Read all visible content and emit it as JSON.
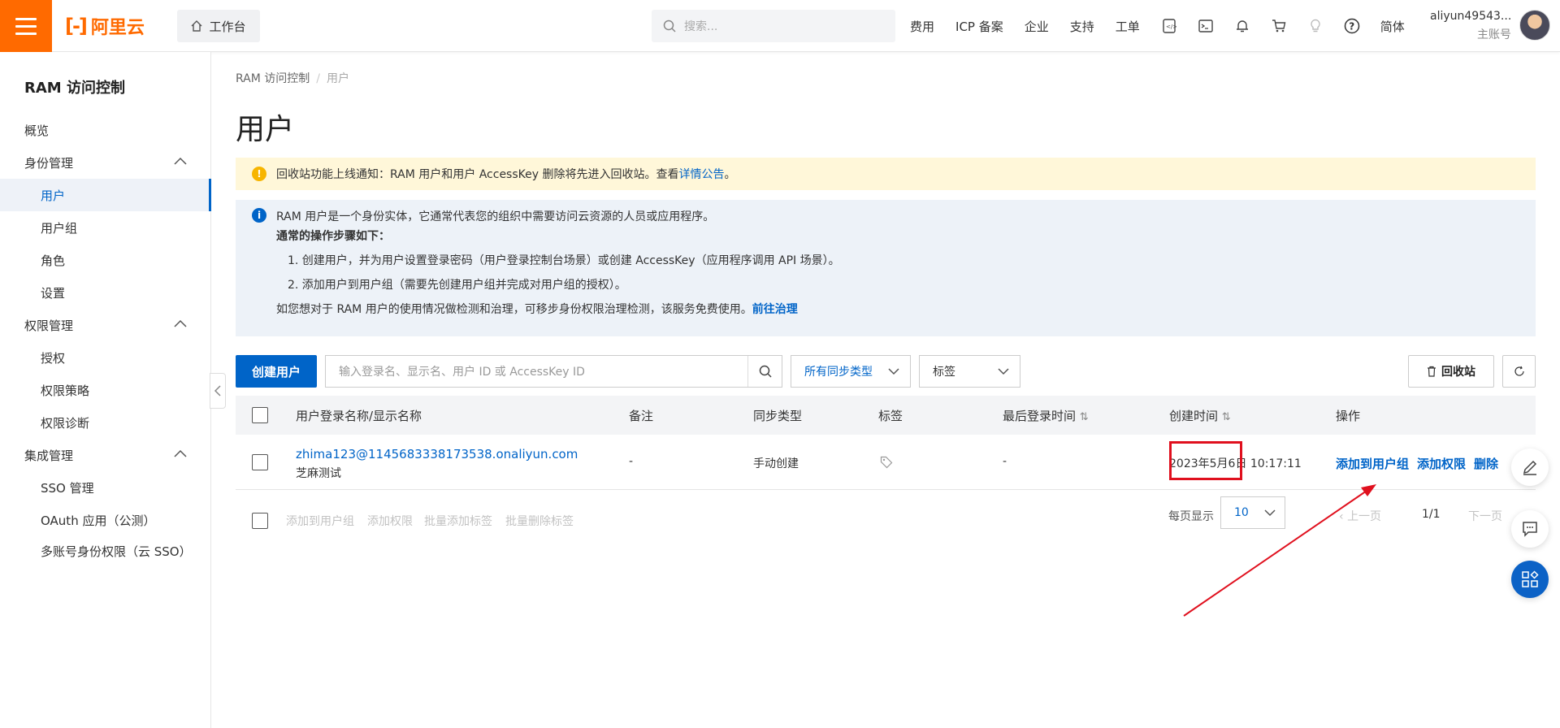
{
  "topbar": {
    "logo_text": "阿里云",
    "workbench_label": "工作台",
    "search_placeholder": "搜索...",
    "nav": [
      "费用",
      "ICP 备案",
      "企业",
      "支持",
      "工单"
    ],
    "language": "简体",
    "account_name": "aliyun49543...",
    "account_role": "主账号",
    "brand_color": "#ff6a00"
  },
  "sidebar": {
    "title": "RAM 访问控制",
    "items": [
      {
        "label": "概览"
      },
      {
        "label": "身份管理"
      },
      {
        "label": "用户"
      },
      {
        "label": "用户组"
      },
      {
        "label": "角色"
      },
      {
        "label": "设置"
      },
      {
        "label": "权限管理"
      },
      {
        "label": "授权"
      },
      {
        "label": "权限策略"
      },
      {
        "label": "权限诊断"
      },
      {
        "label": "集成管理"
      },
      {
        "label": "SSO 管理"
      },
      {
        "label": "OAuth 应用（公测）"
      },
      {
        "label": "多账号身份权限（云 SSO）"
      }
    ]
  },
  "breadcrumb": {
    "root": "RAM 访问控制",
    "sep": "/",
    "current": "用户"
  },
  "page_title": "用户",
  "notice_yellow": {
    "text": "回收站功能上线通知：RAM 用户和用户 AccessKey 删除将先进入回收站。查看",
    "link": "详情公告",
    "end": "。"
  },
  "notice_blue": {
    "line1": "RAM 用户是一个身份实体，它通常代表您的组织中需要访问云资源的人员或应用程序。",
    "line2": "通常的操作步骤如下：",
    "step1": "1. 创建用户，并为用户设置登录密码（用户登录控制台场景）或创建 AccessKey（应用程序调用 API 场景）。",
    "step2": "2. 添加用户到用户组（需要先创建用户组并完成对用户组的授权）。",
    "line5": "如您想对于 RAM 用户的使用情况做检测和治理，可移步身份权限治理检测，该服务免费使用。",
    "line5_link": "前往治理"
  },
  "toolbar": {
    "create_label": "创建用户",
    "search_placeholder": "输入登录名、显示名、用户 ID 或 AccessKey ID",
    "sync_select": "所有同步类型",
    "tag_select": "标签",
    "recycle_label": "回收站"
  },
  "table": {
    "headers": [
      "用户登录名称/显示名称",
      "备注",
      "同步类型",
      "标签",
      "最后登录时间",
      "创建时间",
      "操作"
    ],
    "rows": [
      {
        "login": "zhima123@1145683338173538.onaliyun.com",
        "display": "芝麻测试",
        "note": "-",
        "sync": "手动创建",
        "last_login": "-",
        "created": "2023年5月6日 10:17:11",
        "actions": [
          "添加到用户组",
          "添加权限",
          "删除"
        ]
      }
    ]
  },
  "footer": {
    "bulk_actions": [
      "添加到用户组",
      "添加权限",
      "批量添加标签",
      "批量删除标签"
    ],
    "page_size_label": "每页显示",
    "page_size": "10",
    "prev": "上一页",
    "page": "1/1",
    "next": "下一页"
  }
}
